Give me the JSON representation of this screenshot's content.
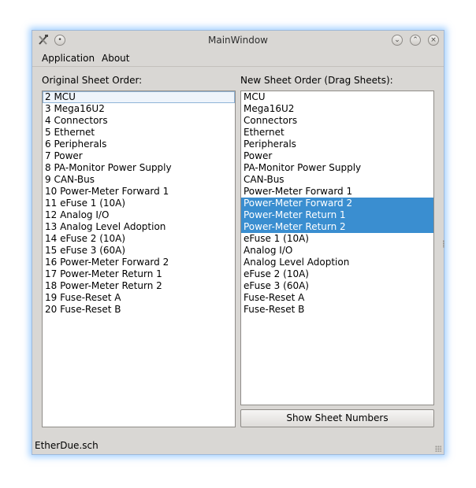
{
  "window": {
    "title": "MainWindow"
  },
  "menu": {
    "application": "Application",
    "about": "About"
  },
  "left": {
    "label": "Original Sheet Order:",
    "items": [
      "2 MCU",
      "3 Mega16U2",
      "4 Connectors",
      "5 Ethernet",
      "6 Peripherals",
      "7 Power",
      "8 PA-Monitor Power Supply",
      "9 CAN-Bus",
      "10 Power-Meter Forward 1",
      "11 eFuse 1 (10A)",
      "12 Analog I/O",
      "13 Analog Level Adoption",
      "14 eFuse 2 (10A)",
      "15 eFuse 3 (60A)",
      "16 Power-Meter Forward 2",
      "17 Power-Meter Return 1",
      "18 Power-Meter Return 2",
      "19 Fuse-Reset A",
      "20 Fuse-Reset B"
    ]
  },
  "right": {
    "label": "New Sheet Order (Drag Sheets):",
    "items": [
      "MCU",
      "Mega16U2",
      "Connectors",
      "Ethernet",
      "Peripherals",
      "Power",
      "PA-Monitor Power Supply",
      "CAN-Bus",
      "Power-Meter Forward 1",
      "Power-Meter Forward 2",
      "Power-Meter Return 1",
      "Power-Meter Return 2",
      "eFuse 1 (10A)",
      "Analog I/O",
      "Analog Level Adoption",
      "eFuse 2 (10A)",
      "eFuse 3 (60A)",
      "Fuse-Reset A",
      "Fuse-Reset B"
    ],
    "selected_indices": [
      9,
      10,
      11
    ],
    "button": "Show Sheet Numbers"
  },
  "status": {
    "text": "EtherDue.sch"
  },
  "colors": {
    "selection": "#3a8ed0",
    "window_bg": "#d9d7d4",
    "glow": "#5aaaff"
  }
}
